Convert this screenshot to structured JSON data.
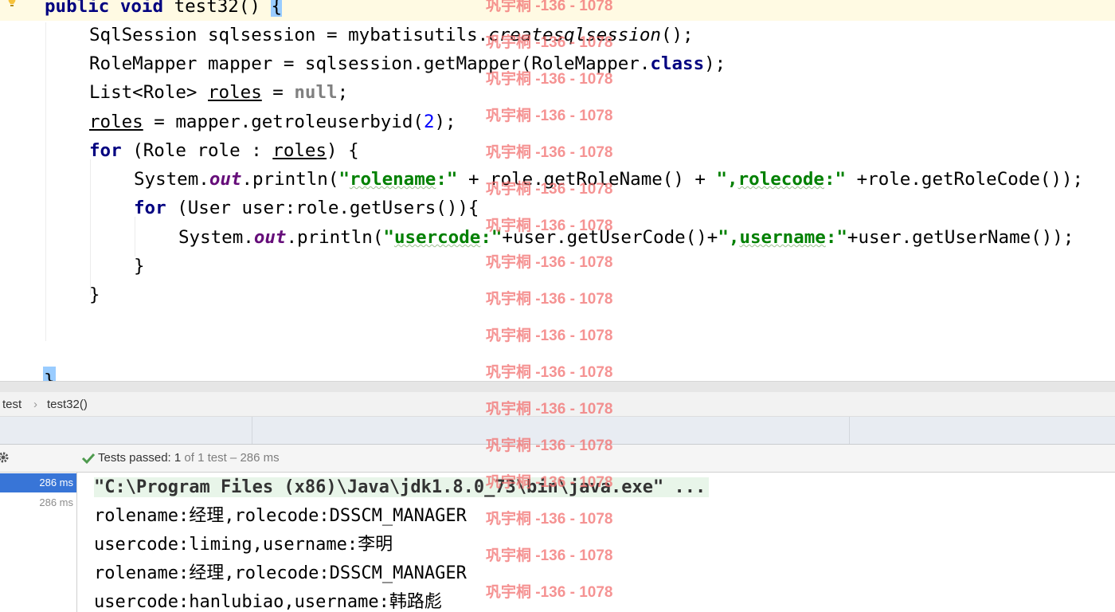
{
  "editor": {
    "lines": [
      {
        "id": "l1",
        "tokens": [
          {
            "t": "public ",
            "c": "kw"
          },
          {
            "t": "void ",
            "c": "kw"
          },
          {
            "t": "test32() ",
            "c": ""
          },
          {
            "t": "{",
            "c": "brace-hl"
          }
        ]
      },
      {
        "id": "l2",
        "tokens": [
          {
            "t": "SqlSession sqlsession = mybatisutils.",
            "c": ""
          },
          {
            "t": "createsqlsession",
            "c": "italic"
          },
          {
            "t": "();",
            "c": ""
          }
        ]
      },
      {
        "id": "l3",
        "tokens": [
          {
            "t": "RoleMapper mapper = sqlsession.getMapper(RoleMapper.",
            "c": ""
          },
          {
            "t": "class",
            "c": "kw"
          },
          {
            "t": ");",
            "c": ""
          }
        ]
      },
      {
        "id": "l4",
        "tokens": [
          {
            "t": "List<Role> ",
            "c": ""
          },
          {
            "t": "roles",
            "c": "ul"
          },
          {
            "t": " = ",
            "c": ""
          },
          {
            "t": "null",
            "c": "gray"
          },
          {
            "t": ";",
            "c": ""
          }
        ]
      },
      {
        "id": "l5",
        "tokens": [
          {
            "t": "roles",
            "c": "ul"
          },
          {
            "t": " = mapper.getroleuserbyid(",
            "c": ""
          },
          {
            "t": "2",
            "c": "num"
          },
          {
            "t": ");",
            "c": ""
          }
        ]
      },
      {
        "id": "l6",
        "tokens": [
          {
            "t": "for ",
            "c": "kw"
          },
          {
            "t": "(Role role : ",
            "c": ""
          },
          {
            "t": "roles",
            "c": "ul"
          },
          {
            "t": ") {",
            "c": ""
          }
        ]
      },
      {
        "id": "l7",
        "tokens": [
          {
            "t": "System.",
            "c": ""
          },
          {
            "t": "out",
            "c": "field"
          },
          {
            "t": ".println(",
            "c": ""
          },
          {
            "t": "\"",
            "c": "str"
          },
          {
            "t": "rolename",
            "c": "str squig"
          },
          {
            "t": ":\"",
            "c": "str"
          },
          {
            "t": " + role.getRoleName() + ",
            "c": ""
          },
          {
            "t": "\",",
            "c": "str"
          },
          {
            "t": "rolecode",
            "c": "str squig"
          },
          {
            "t": ":\"",
            "c": "str"
          },
          {
            "t": " +role.getRoleCode());",
            "c": ""
          }
        ]
      },
      {
        "id": "l8",
        "tokens": [
          {
            "t": "for ",
            "c": "kw"
          },
          {
            "t": "(User user:role.getUsers()){",
            "c": ""
          }
        ]
      },
      {
        "id": "l9",
        "tokens": [
          {
            "t": "System.",
            "c": ""
          },
          {
            "t": "out",
            "c": "field"
          },
          {
            "t": ".println(",
            "c": ""
          },
          {
            "t": "\"",
            "c": "str"
          },
          {
            "t": "usercode",
            "c": "str squig"
          },
          {
            "t": ":\"",
            "c": "str"
          },
          {
            "t": "+user.getUserCode()+",
            "c": ""
          },
          {
            "t": "\",",
            "c": "str"
          },
          {
            "t": "username",
            "c": "str squig"
          },
          {
            "t": ":\"",
            "c": "str"
          },
          {
            "t": "+user.getUserName());",
            "c": ""
          }
        ]
      },
      {
        "id": "l10",
        "tokens": [
          {
            "t": "}",
            "c": ""
          }
        ]
      },
      {
        "id": "l11",
        "tokens": [
          {
            "t": "}",
            "c": ""
          }
        ]
      }
    ],
    "closing_brace": "}"
  },
  "breadcrumb": {
    "items": [
      "test",
      "test32()"
    ],
    "separator": "›"
  },
  "run_toolbar": {
    "status_prefix": "Tests passed: ",
    "passed": "1",
    "rest": " of 1 test – 286 ms"
  },
  "test_tree": {
    "rows": [
      "286 ms",
      "286 ms"
    ]
  },
  "console": {
    "lines": [
      "\"C:\\Program Files (x86)\\Java\\jdk1.8.0_73\\bin\\java.exe\" ...",
      "rolename:经理,rolecode:DSSCM_MANAGER",
      "usercode:liming,username:李明",
      "rolename:经理,rolecode:DSSCM_MANAGER",
      "usercode:hanlubiao,username:韩路彪"
    ]
  },
  "watermark": {
    "text": "巩宇桐 -136 - 1078"
  },
  "colors": {
    "keyword": "#000080",
    "string": "#008000",
    "field": "#660e7a",
    "number": "#0000ff",
    "watermark": "#f26f6f",
    "selection": "#3875d7"
  },
  "icons": [
    "lightbulb-icon",
    "gear-icon",
    "check-icon"
  ]
}
